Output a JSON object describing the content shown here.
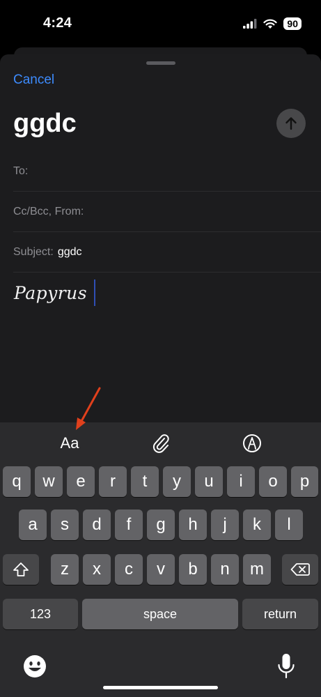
{
  "status_bar": {
    "time": "4:24",
    "battery": "90"
  },
  "compose": {
    "cancel_label": "Cancel",
    "title": "ggdc",
    "to_label": "To:",
    "ccbcc_label": "Cc/Bcc, From:",
    "subject_label": "Subject:",
    "subject_value": "ggdc",
    "body_text": "Papyrus"
  },
  "toolbar": {
    "format_label": "Aa",
    "attach_icon": "paperclip-icon",
    "markup_icon": "markup-pen-icon"
  },
  "keyboard": {
    "row1": [
      "q",
      "w",
      "e",
      "r",
      "t",
      "y",
      "u",
      "i",
      "o",
      "p"
    ],
    "row2": [
      "a",
      "s",
      "d",
      "f",
      "g",
      "h",
      "j",
      "k",
      "l"
    ],
    "row3": [
      "z",
      "x",
      "c",
      "v",
      "b",
      "n",
      "m"
    ],
    "numbers_label": "123",
    "space_label": "space",
    "return_label": "return"
  },
  "colors": {
    "accent": "#3d8bfd",
    "annotation": "#e0401c"
  }
}
